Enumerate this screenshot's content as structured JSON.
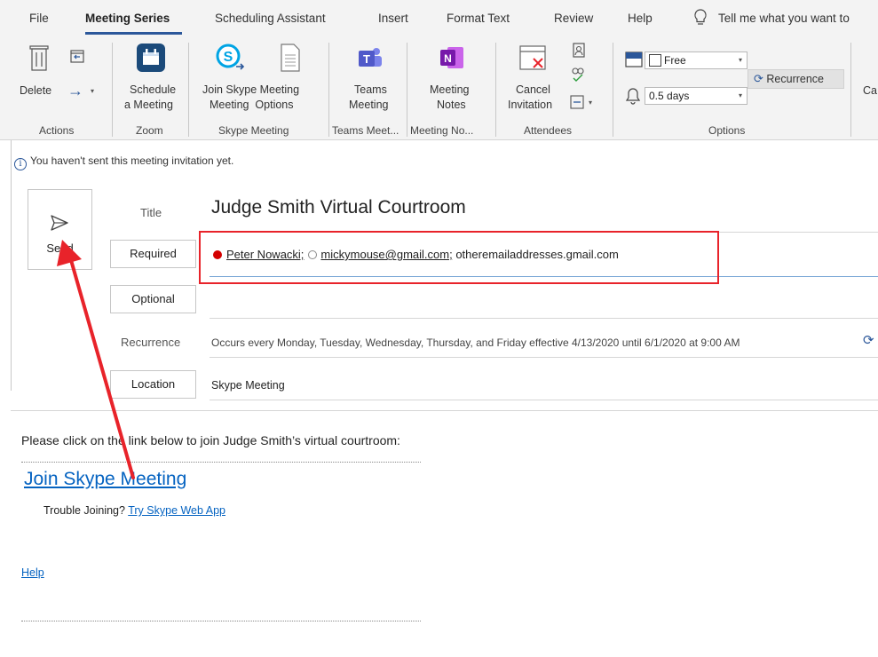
{
  "tabs": [
    "File",
    "Meeting Series",
    "Scheduling Assistant",
    "Insert",
    "Format Text",
    "Review",
    "Help"
  ],
  "tell_me": "Tell me what you want to",
  "ribbon": {
    "delete_label": "Delete",
    "schedule_l1": "Schedule",
    "schedule_l2": "a Meeting",
    "skype_l1": "Join Skype Meeting",
    "skype_l2": "Meeting  Options",
    "teams_l1": "Teams",
    "teams_l2": "Meeting",
    "notes_l1": "Meeting",
    "notes_l2": "Notes",
    "cancel_l1": "Cancel",
    "cancel_l2": "Invitation",
    "show_as": "Free",
    "reminder": "0.5 days",
    "recurrence_label": "Recurrence",
    "cut_label": "Ca",
    "groups": {
      "actions": "Actions",
      "zoom": "Zoom",
      "skype": "Skype Meeting",
      "teams": "Teams Meet...",
      "notes": "Meeting No...",
      "attendees": "Attendees",
      "options": "Options"
    }
  },
  "info": {
    "text": "You haven't sent this meeting invitation yet."
  },
  "form": {
    "send_label": "Send",
    "title_label": "Title",
    "title_value": "Judge Smith Virtual Courtroom",
    "required_label": "Required",
    "recipient1": "Peter Nowacki;",
    "recipient2": "mickymouse@gmail.com;",
    "recipient3": "otheremailaddresses.gmail.com",
    "optional_label": "Optional",
    "recurrence_label": "Recurrence",
    "recurrence_value": "Occurs every Monday, Tuesday, Wednesday, Thursday, and Friday effective 4/13/2020 until 6/1/2020 at 9:00 AM",
    "location_label": "Location",
    "location_value": "Skype Meeting"
  },
  "body": {
    "intro": "Please click on the link below to join Judge Smith’s virtual courtroom:",
    "join_link": "Join Skype Meeting",
    "trouble_prefix": "Trouble Joining?",
    "trouble_link": "Try Skype Web App",
    "help": "Help"
  },
  "colors": {
    "accent": "#2b579a",
    "highlight_box": "#e8232a",
    "arrow": "#e8232a",
    "link": "#0563c1"
  }
}
